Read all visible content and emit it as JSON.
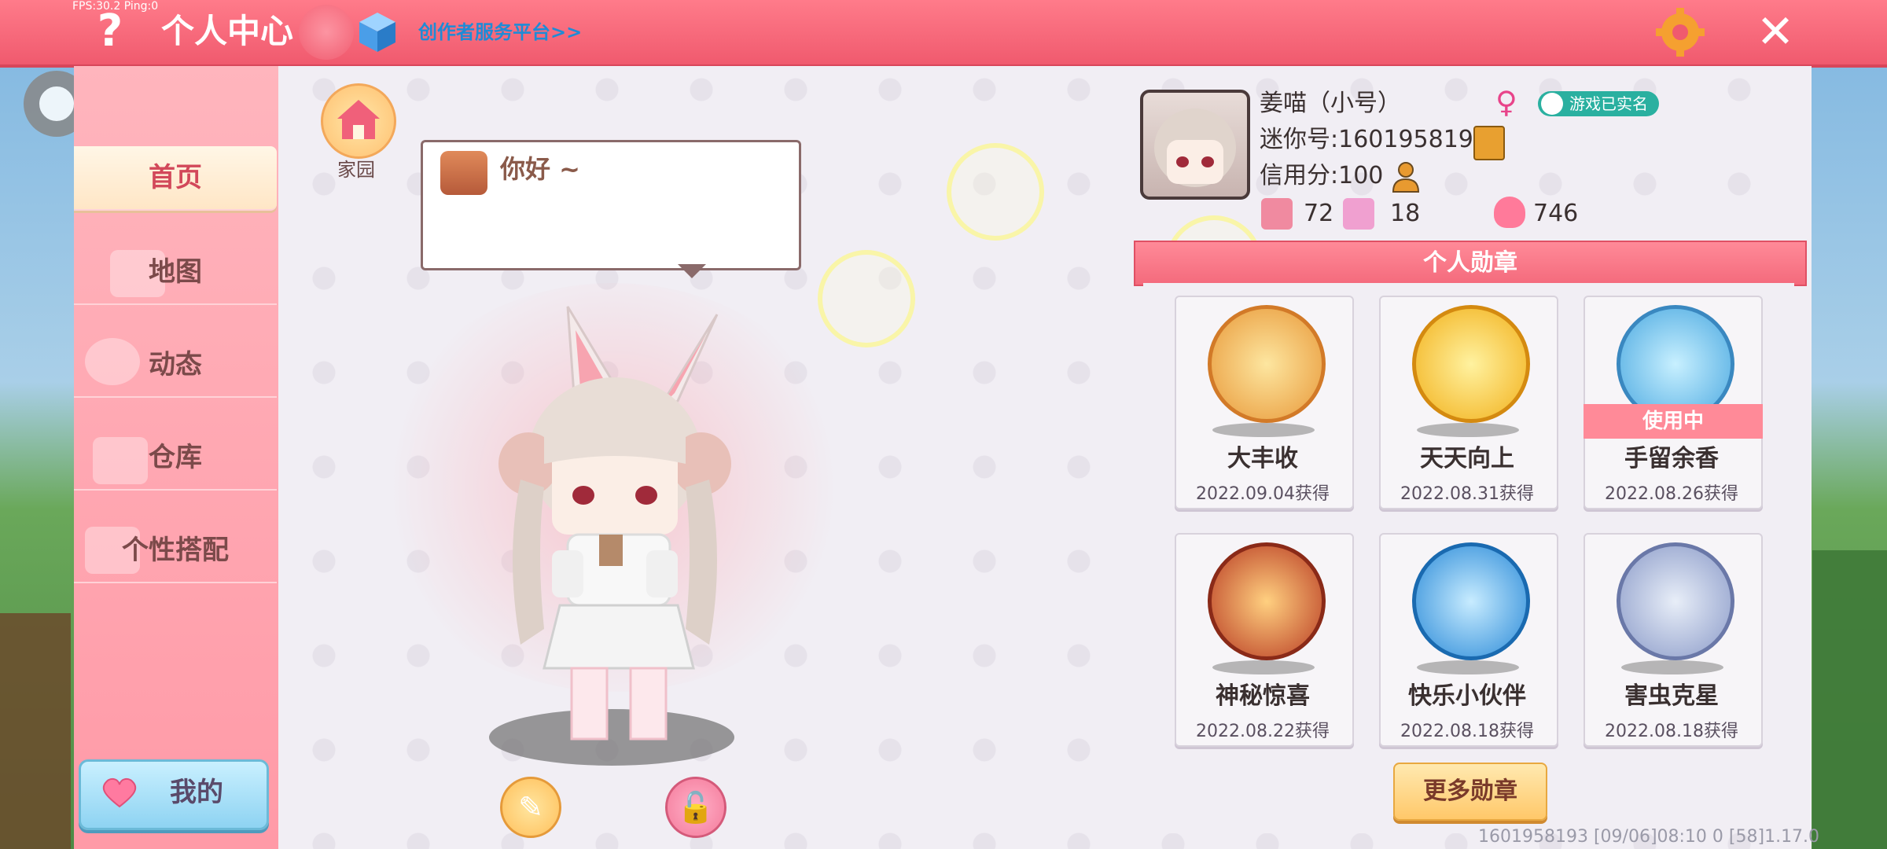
{
  "debug": {
    "fps_text": "FPS:30.2  Ping:0"
  },
  "header": {
    "title": "个人中心",
    "creator_link": "创作者服务平台>>",
    "help_icon": "question-icon",
    "settings_icon": "gear-icon",
    "close_icon": "close-icon"
  },
  "sidebar": {
    "items": [
      {
        "label": "首页",
        "active": true
      },
      {
        "label": "地图",
        "active": false
      },
      {
        "label": "动态",
        "active": false
      },
      {
        "label": "仓库",
        "active": false
      },
      {
        "label": "个性搭配",
        "active": false
      }
    ],
    "mine_label": "我的"
  },
  "home": {
    "label": "家园"
  },
  "greeting": {
    "text": "你好 ~"
  },
  "profile": {
    "name": "姜喵（小号）",
    "gender_symbol": "♀",
    "verified_label": "游戏已实名",
    "mini_id": "迷你号:1601958193",
    "credit": "信用分:100",
    "stats": [
      {
        "icon": "bookmark-icon",
        "value": "72"
      },
      {
        "icon": "fans-icon",
        "value": "18"
      },
      {
        "icon": "flame-icon",
        "value": "746"
      }
    ]
  },
  "badges": {
    "title": "个人勋章",
    "in_use_label": "使用中",
    "items": [
      {
        "name": "大丰收",
        "date": "2022.09.04获得",
        "color": "#f0a040"
      },
      {
        "name": "天天向上",
        "date": "2022.08.31获得",
        "color": "#f5b820"
      },
      {
        "name": "手留余香",
        "date": "2022.08.26获得",
        "color": "#5ab8e8"
      },
      {
        "name": "神秘惊喜",
        "date": "2022.08.22获得",
        "color": "#c8402a"
      },
      {
        "name": "快乐小伙伴",
        "date": "2022.08.18获得",
        "color": "#3a9ee0"
      },
      {
        "name": "害虫克星",
        "date": "2022.08.18获得",
        "color": "#8a9ac8"
      }
    ],
    "more_label": "更多勋章"
  },
  "footer": {
    "text": "1601958193    [09/06]08:10 0  [58]1.17.0"
  },
  "colors": {
    "accent": "#f05a6e",
    "teal": "#2ab0a0"
  }
}
